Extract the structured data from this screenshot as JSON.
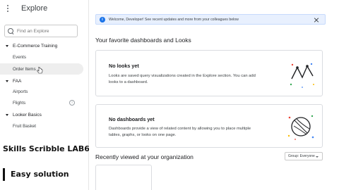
{
  "sidebar": {
    "title": "Explore",
    "search_placeholder": "Find an Explore",
    "sections": [
      {
        "label": "E-Commerce Training",
        "items": [
          "Events",
          "Order Items"
        ]
      },
      {
        "label": "FAA",
        "items": [
          "Airports",
          "Flights"
        ]
      },
      {
        "label": "Looker Basics",
        "items": [
          "Fruit Basket"
        ]
      }
    ]
  },
  "overlay": {
    "line1": "Skills Scribble LAB6",
    "line2": "Easy solution"
  },
  "main": {
    "banner_text": "Welcome, Developer! See recent updates and more from your colleagues below",
    "favorites_heading": "Your favorite dashboards and Looks",
    "looks_card": {
      "title": "No looks yet",
      "description_line1": "Looks are saved query visualizations created in the Explore section. You can add",
      "description_line2": "looks to a dashboard."
    },
    "dashboards_card": {
      "title": "No dashboards yet",
      "description_line1": "Dashboards provide a view of related content by allowing you to place multiple",
      "description_line2": "tables, graphs, or looks on one page."
    },
    "recent_heading": "Recently viewed at your organization",
    "group_select": "Group: Everyone"
  },
  "colors": {
    "accent_blue": "#1a73e8",
    "banner_bg": "#e8f0fe",
    "active_item_bg": "#eeeeee"
  }
}
